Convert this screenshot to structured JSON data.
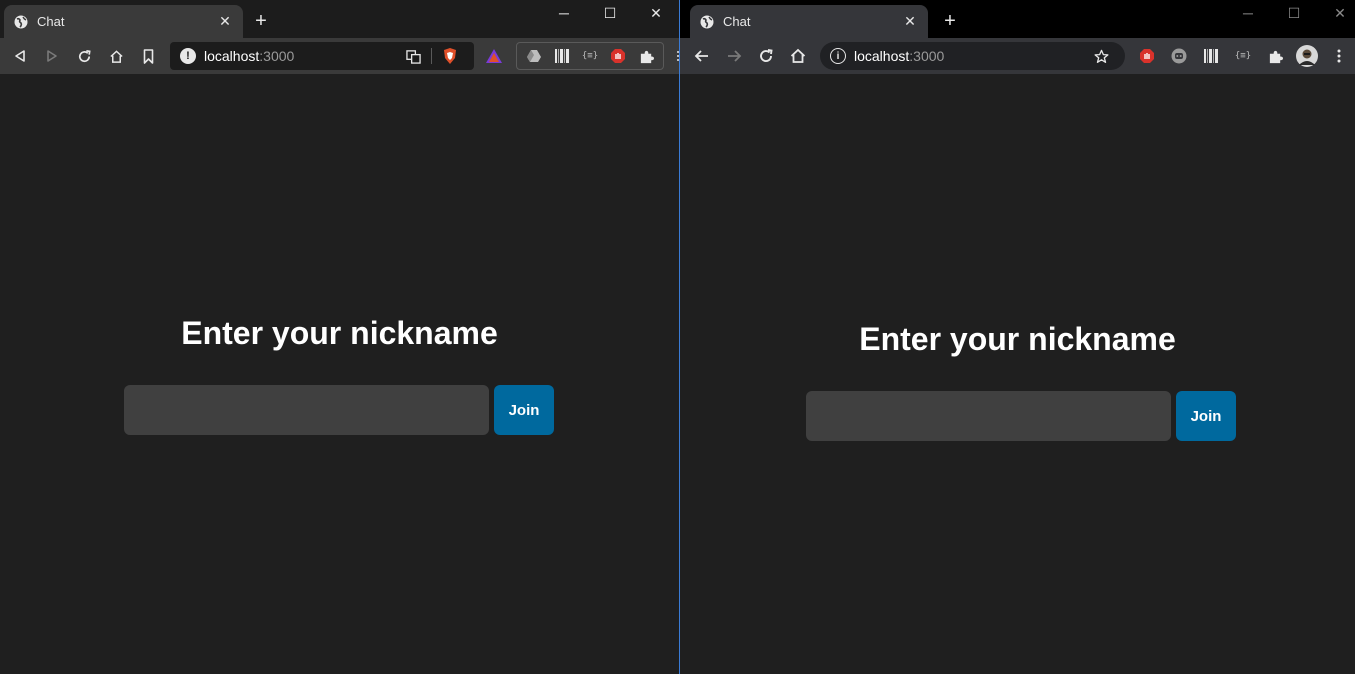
{
  "left_browser": {
    "tab": {
      "title": "Chat",
      "close": "✕"
    },
    "new_tab": "+",
    "window_controls": {
      "minimize": "─",
      "maximize": "☐",
      "close": "✕"
    },
    "address": {
      "host": "localhost",
      "port": ":3000"
    },
    "page": {
      "heading": "Enter your nickname",
      "input_value": "",
      "button_label": "Join"
    }
  },
  "right_browser": {
    "tab": {
      "title": "Chat",
      "close": "✕"
    },
    "new_tab": "+",
    "window_controls": {
      "minimize": "─",
      "maximize": "☐",
      "close": "✕"
    },
    "address": {
      "host": "localhost",
      "port": ":3000"
    },
    "page": {
      "heading": "Enter your nickname",
      "input_value": "",
      "button_label": "Join"
    }
  },
  "colors": {
    "page_background": "#1f1f1f",
    "input_background": "#404040",
    "button_accent": "#00699e",
    "divider": "#3a7bd5"
  }
}
